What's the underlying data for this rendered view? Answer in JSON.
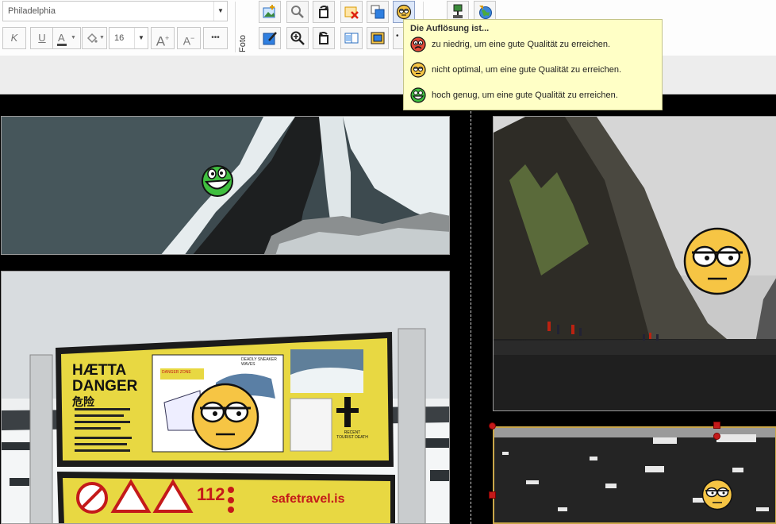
{
  "ribbon": {
    "font_name": "Philadelphia",
    "italic_label": "K",
    "underline_label": "U",
    "text_color_label": "A",
    "font_size": "16",
    "grow_label": "A",
    "shrink_label": "A",
    "more_label": "•••",
    "group_label": "Foto"
  },
  "tooltip": {
    "title": "Die Auflösung ist...",
    "items": [
      {
        "text": "zu niedrig, um eine gute Qualität zu erreichen.",
        "level": "low",
        "icon": "sad-red-smiley-icon"
      },
      {
        "text": "nicht optimal, um eine gute Qualität zu erreichen.",
        "level": "medium",
        "icon": "neutral-yellow-smiley-icon"
      },
      {
        "text": "hoch genug, um eine gute Qualität zu erreichen.",
        "level": "high",
        "icon": "happy-green-smiley-icon"
      }
    ]
  },
  "photos": [
    {
      "id": "black-beach-waves",
      "quality": "high"
    },
    {
      "id": "basalt-cliffs",
      "quality": "medium"
    },
    {
      "id": "danger-sign",
      "quality": "medium"
    },
    {
      "id": "black-sand",
      "quality": "medium"
    }
  ],
  "sign": {
    "heading1": "HÆTTA",
    "heading2": "DANGER",
    "heading3": "危险",
    "danger_zone": "DANGER ZONE",
    "deadly_waves": "DEADLY SNEAKER WAVES",
    "recent_death": "RECENT TOURIST DEATH",
    "emergency_number": "112",
    "website": "safetravel.is"
  },
  "colors": {
    "accent_red": "#c41a1a",
    "tooltip_bg": "#ffffc6",
    "smiley_yellow": "#f6c544",
    "smiley_green": "#3fbf3f",
    "sign_yellow": "#e8d842"
  }
}
